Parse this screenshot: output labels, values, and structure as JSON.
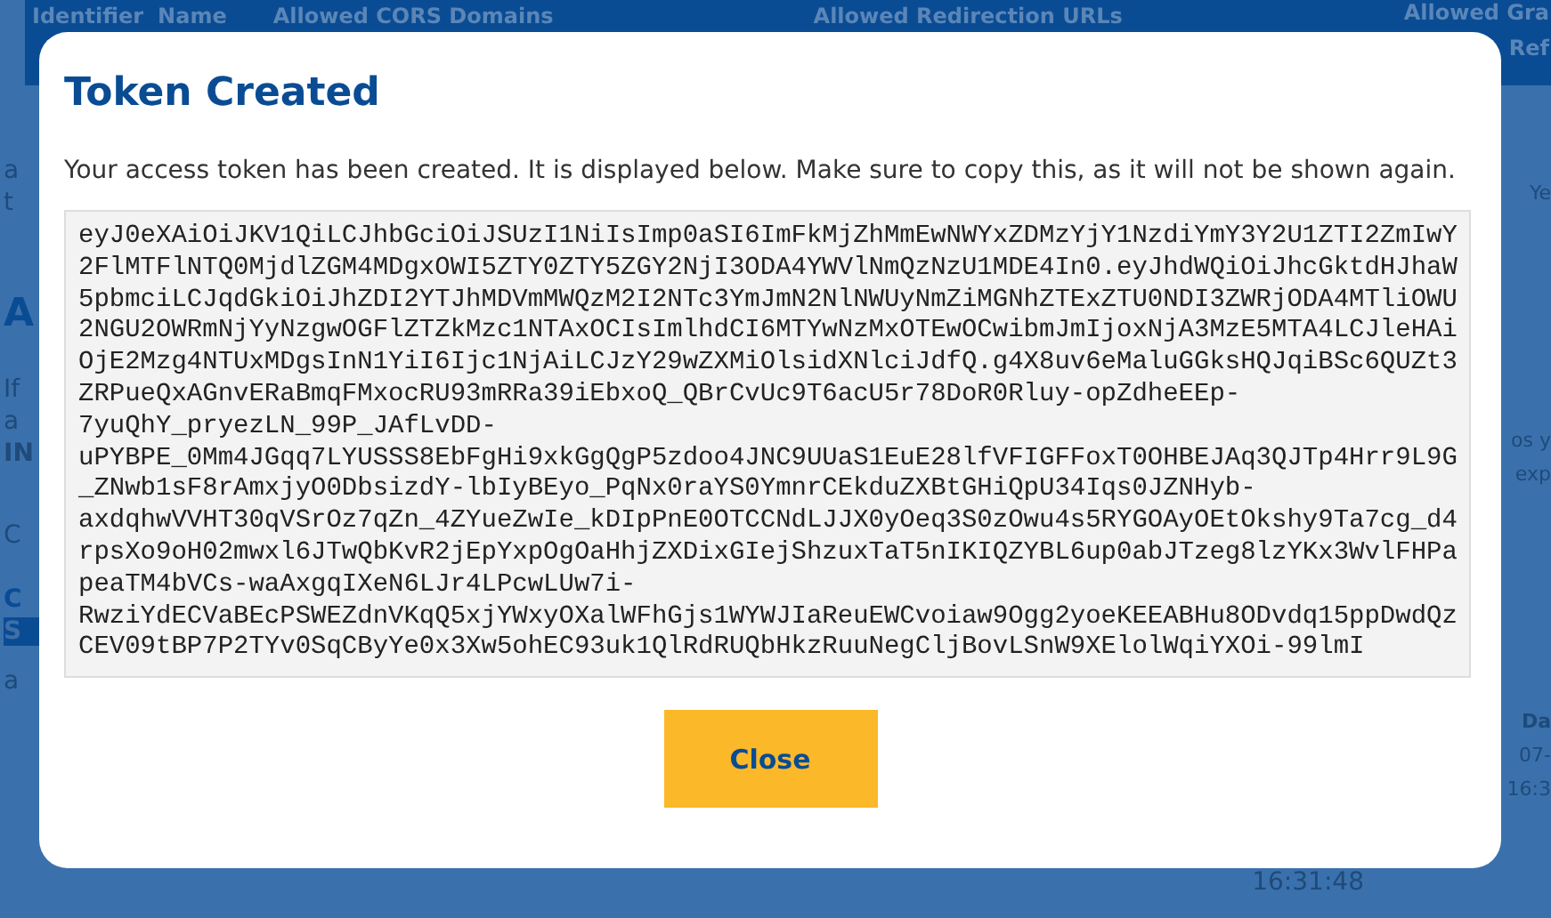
{
  "background": {
    "columns": [
      "Identifier",
      "Name",
      "Allowed CORS Domains",
      "Allowed Redirection URLs"
    ],
    "corner": [
      "Allowed Gra",
      "Ref"
    ],
    "left_fragments": [
      "a",
      "t",
      "A",
      "If",
      "a",
      "IN",
      "C",
      "C",
      "S",
      "a"
    ],
    "right_fragments": [
      "Ye",
      "os y",
      "exp",
      "Da",
      "07-",
      "16:3"
    ],
    "bottom_time": "16:31:48"
  },
  "modal": {
    "title": "Token Created",
    "message": "Your access token has been created. It is displayed below. Make sure to copy this, as it will not be shown again.",
    "token": "eyJ0eXAiOiJKV1QiLCJhbGciOiJSUzI1NiIsImp0aSI6ImFkMjZhMmEwNWYxZDMzYjY1NzdiYmY3Y2U1ZTI2ZmIwY2FlMTFlNTQ0MjdlZGM4MDgxOWI5ZTY0ZTY5ZGY2NjI3ODA4YWVlNmQzNzU1MDE4In0.eyJhdWQiOiJhcGktdHJhaW5pbmciLCJqdGkiOiJhZDI2YTJhMDVmMWQzM2I2NTc3YmJmN2NlNWUyNmZiMGNhZTExZTU0NDI3ZWRjODA4MTliOWU2NGU2OWRmNjYyNzgwOGFlZTZkMzc1NTAxOCIsImlhdCI6MTYwNzMxOTEwOCwibmJmIjoxNjA3MzE5MTA4LCJleHAiOjE2Mzg4NTUxMDgsInN1YiI6Ijc1NjAiLCJzY29wZXMiOlsidXNlciJdfQ.g4X8uv6eMaluGGksHQJqiBSc6QUZt3ZRPueQxAGnvERaBmqFMxocRU93mRRa39iEbxoQ_QBrCvUc9T6acU5r78DoR0Rluy-opZdheEEp-7yuQhY_pryezLN_99P_JAfLvDD-uPYBPE_0Mm4JGqq7LYUSSS8EbFgHi9xkGgQgP5zdoo4JNC9UUaS1EuE28lfVFIGFFoxT0OHBEJAq3QJTp4Hrr9L9G_ZNwb1sF8rAmxjyO0DbsizdY-lbIyBEyo_PqNx0raYS0YmnrCEkduZXBtGHiQpU34Iqs0JZNHyb-axdqhwVVHT30qVSrOz7qZn_4ZYueZwIe_kDIpPnE0OTCCNdLJJX0yOeq3S0zOwu4s5RYGOAyOEtOkshy9Ta7cg_d4rpsXo9oH02mwxl6JTwQbKvR2jEpYxpOgOaHhjZXDixGIejShzuxTaT5nIKIQZYBL6up0abJTzeg8lzYKx3WvlFHPapeaTM4bVCs-waAxgqIXeN6LJr4LPcwLUw7i-RwziYdECVaBEcPSWEZdnVKqQ5xjYWxyOXalWFhGjs1WYWJIaReuEWCvoiaw9Ogg2yoeKEEABHu8ODvdq15ppDwdQzCEV09tBP7P2TYv0SqCByYe0x3Xw5ohEC93uk1QlRdRUQbHkzRuuNegCljBovLSnW9XElolWqiYXOi-99lmI",
    "button": "Close"
  }
}
